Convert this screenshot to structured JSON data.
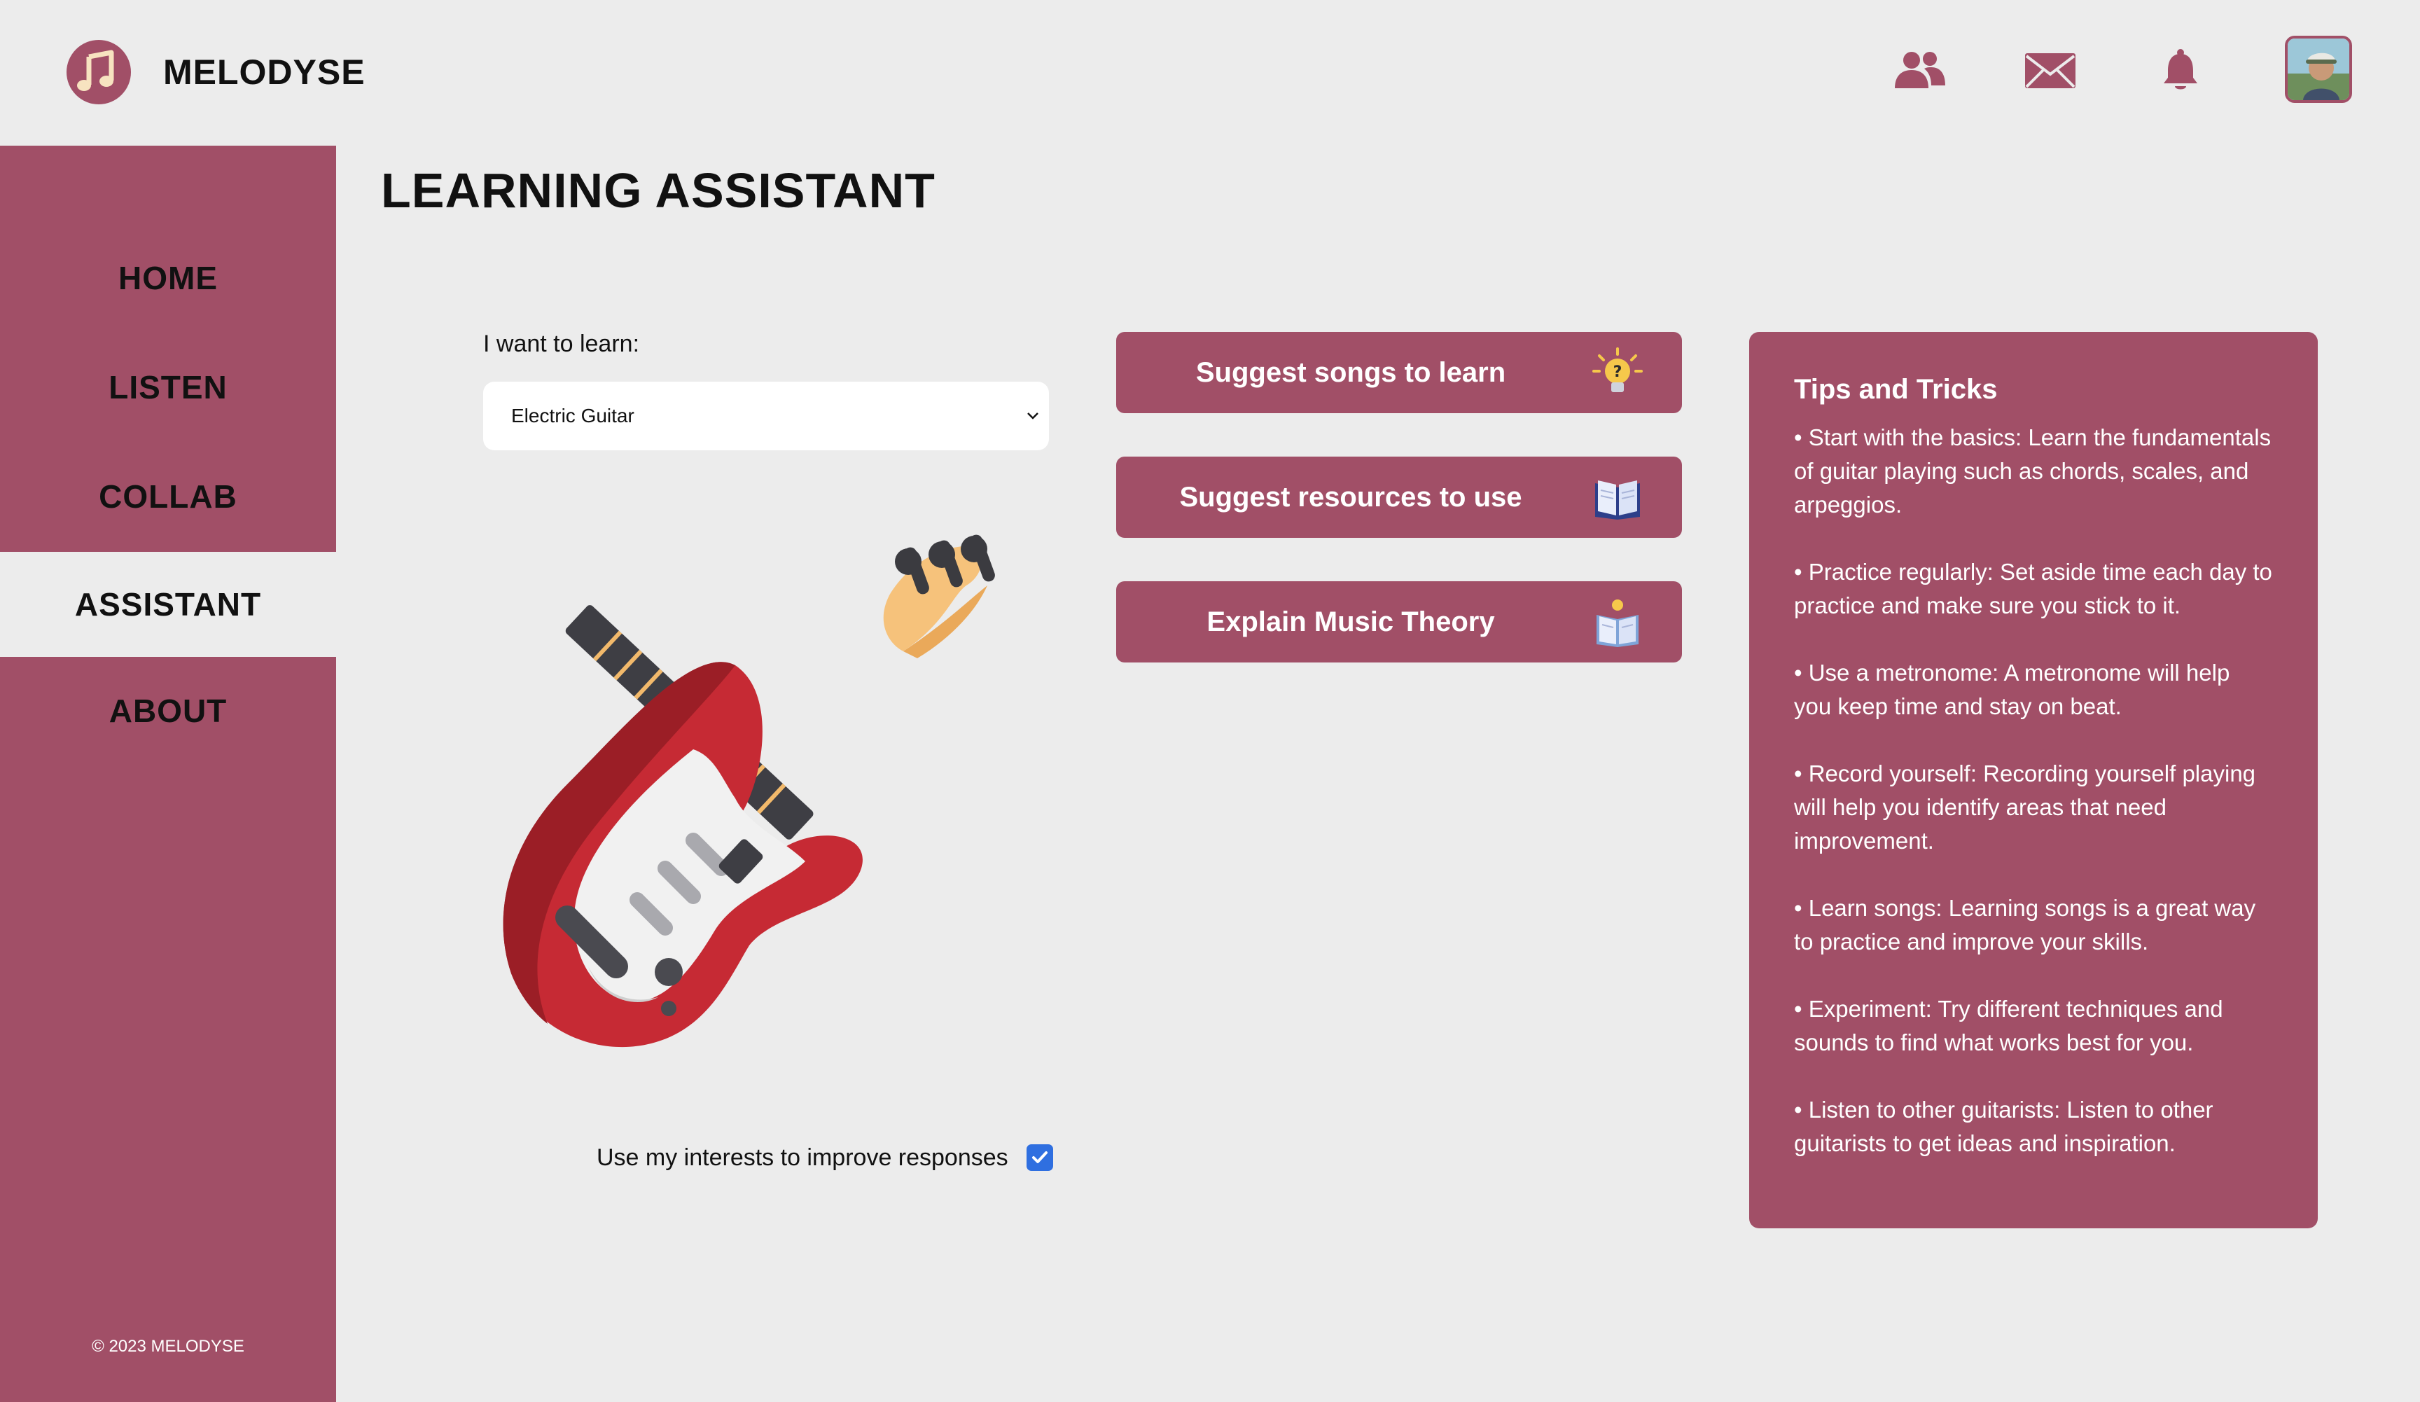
{
  "app": {
    "name": "MELODYSE",
    "logo_icon": "music-note-logo-icon"
  },
  "header": {
    "icons": [
      {
        "name": "friends-icon"
      },
      {
        "name": "mail-icon"
      },
      {
        "name": "bell-icon"
      }
    ]
  },
  "sidebar": {
    "items": [
      {
        "label": "HOME"
      },
      {
        "label": "LISTEN"
      },
      {
        "label": "COLLAB"
      },
      {
        "label": "ASSISTANT",
        "active": true
      },
      {
        "label": "ABOUT"
      }
    ],
    "copyright": "© 2023 MELODYSE"
  },
  "page": {
    "title": "LEARNING ASSISTANT"
  },
  "learn": {
    "label": "I want to learn:",
    "selected": "Electric Guitar",
    "interests_label": "Use my interests to improve responses",
    "interests_checked": true
  },
  "actions": [
    {
      "label": "Suggest songs to learn",
      "icon": "lightbulb-icon"
    },
    {
      "label": "Suggest resources to use",
      "icon": "book-icon"
    },
    {
      "label": "Explain Music Theory",
      "icon": "reading-icon"
    }
  ],
  "tips": {
    "title": "Tips and Tricks",
    "items": [
      " • Start with the basics: Learn the fundamentals of guitar playing such as chords, scales, and arpeggios.",
      "• Practice regularly: Set aside time each day to practice and make sure you stick to it.",
      "• Use a metronome: A metronome will help you keep time and stay on beat.",
      "• Record yourself: Recording yourself playing will help you identify areas that need improvement.",
      "• Learn songs: Learning songs is a great way to practice and improve your skills.",
      "• Experiment: Try different techniques and sounds to find what works best for you.",
      "• Listen to other guitarists: Listen to other guitarists to get ideas and inspiration."
    ]
  },
  "colors": {
    "accent": "#a14f67",
    "background": "#ececec",
    "checkbox": "#2f6fe0"
  }
}
